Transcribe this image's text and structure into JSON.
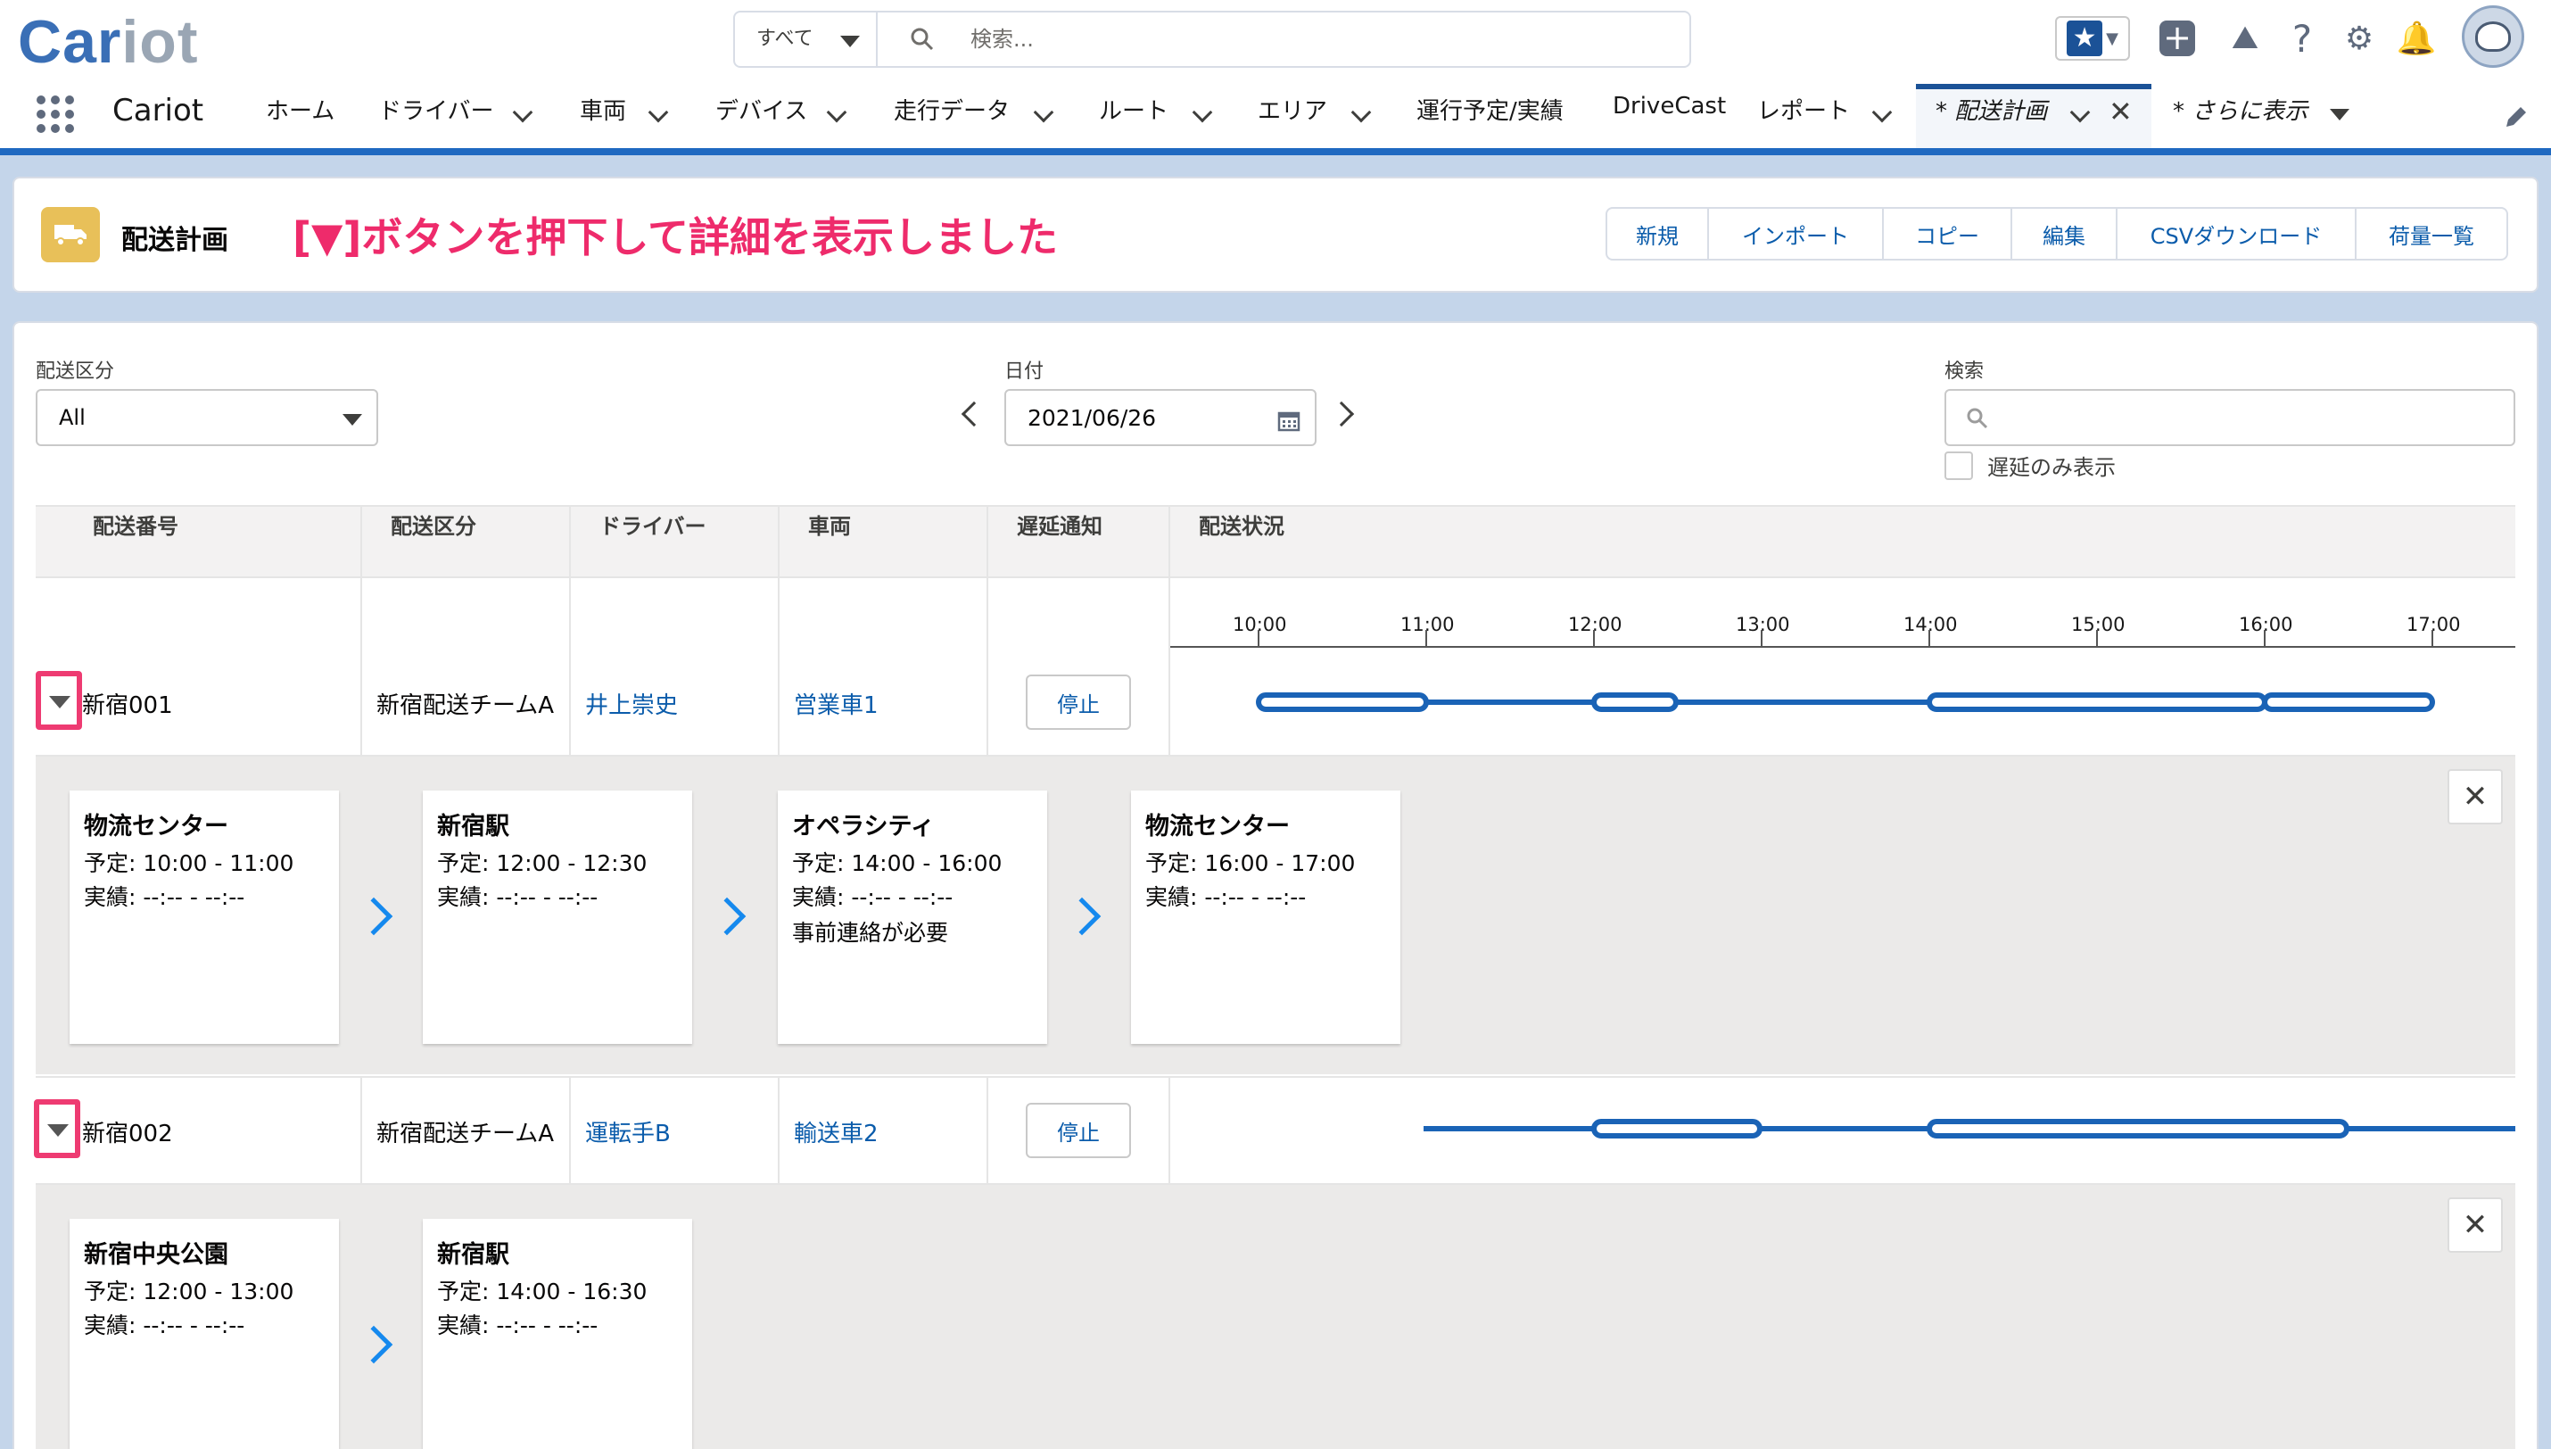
{
  "header": {
    "logo_main": "Car",
    "logo_accent": "iot",
    "search_scope": "すべて",
    "search_placeholder": "検索..."
  },
  "icons": [
    "favorite-star-icon",
    "add-icon",
    "trailhead-icon",
    "help-icon",
    "setup-gear-icon",
    "notification-bell-icon",
    "user-avatar-icon"
  ],
  "nav": {
    "app_name": "Cariot",
    "items": [
      {
        "label": "ホーム"
      },
      {
        "label": "ドライバー"
      },
      {
        "label": "車両"
      },
      {
        "label": "デバイス"
      },
      {
        "label": "走行データ"
      },
      {
        "label": "ルート"
      },
      {
        "label": "エリア"
      },
      {
        "label": "運行予定/実績"
      },
      {
        "label": "DriveCast"
      },
      {
        "label": "レポート"
      }
    ],
    "active_tab": "* 配送計画",
    "more_tab": "* さらに表示"
  },
  "page": {
    "title": "配送計画",
    "annotation": "[▼]ボタンを押下して詳細を表示しました",
    "buttons": [
      "新規",
      "インポート",
      "コピー",
      "編集",
      "CSVダウンロード",
      "荷量一覧"
    ]
  },
  "filters": {
    "type_label": "配送区分",
    "type_value": "All",
    "date_label": "日付",
    "date_value": "2021/06/26",
    "search_label": "検索",
    "delay_only_label": "遅延のみ表示"
  },
  "table": {
    "headers": [
      "配送番号",
      "配送区分",
      "ドライバー",
      "車両",
      "遅延通知",
      "配送状況"
    ],
    "ticks": [
      "10:00",
      "11:00",
      "12:00",
      "13:00",
      "14:00",
      "15:00",
      "16:00",
      "17:00"
    ],
    "rows": [
      {
        "id": "新宿001",
        "type": "新宿配送チームA",
        "driver": "井上崇史",
        "vehicle": "営業車1",
        "stop_label": "停止",
        "stops": [
          {
            "name": "物流センター",
            "plan": "予定:  10:00   -   11:00",
            "actual": "実績:    --:--    -    --:--",
            "note": ""
          },
          {
            "name": "新宿駅",
            "plan": "予定:  12:00   -   12:30",
            "actual": "実績:    --:--    -    --:--",
            "note": ""
          },
          {
            "name": "オペラシティ",
            "plan": "予定:  14:00   -   16:00",
            "actual": "実績:    --:--    -    --:--",
            "note": "事前連絡が必要"
          },
          {
            "name": "物流センター",
            "plan": "予定:  16:00   -   17:00",
            "actual": "実績:    --:--    -    --:--",
            "note": ""
          }
        ]
      },
      {
        "id": "新宿002",
        "type": "新宿配送チームA",
        "driver": "運転手B",
        "vehicle": "輸送車2",
        "stop_label": "停止",
        "stops": [
          {
            "name": "新宿中央公園",
            "plan": "予定:  12:00   -   13:00",
            "actual": "実績:    --:--    -    --:--",
            "note": ""
          },
          {
            "name": "新宿駅",
            "plan": "予定:  14:00   -   16:30",
            "actual": "実績:    --:--    -    --:--",
            "note": ""
          }
        ]
      }
    ]
  }
}
